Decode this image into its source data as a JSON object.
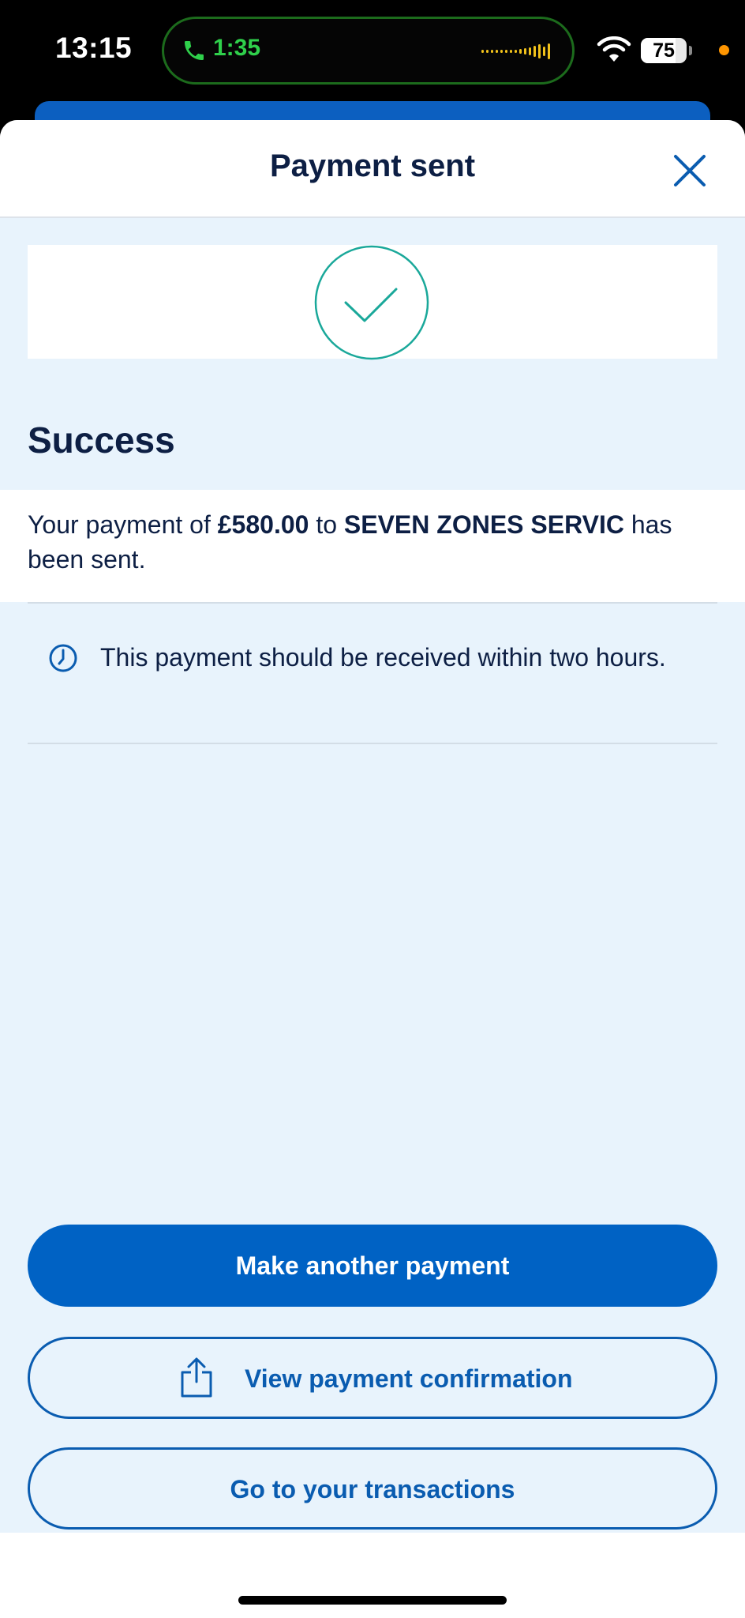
{
  "status_bar": {
    "time": "13:15",
    "call_time": "1:35",
    "battery_percent": "75",
    "battery_level": 0.75
  },
  "header": {
    "title": "Payment sent",
    "close_icon": "close-icon"
  },
  "result": {
    "icon": "checkmark-circle-icon",
    "heading": "Success",
    "message_prefix": "Your payment of ",
    "amount": "£580.00",
    "message_to": " to ",
    "payee": "SEVEN ZONES SERVIC",
    "message_suffix": " has been sent."
  },
  "info": {
    "icon": "clock-icon",
    "text": "This payment should be received within two hours."
  },
  "actions": {
    "make_another": "Make another payment",
    "view_confirmation": "View payment confirmation",
    "view_confirmation_icon": "share-icon",
    "go_transactions": "Go to your transactions"
  },
  "colors": {
    "primary": "#0062c4",
    "navy_text": "#0d1f44",
    "background": "#e8f3fc",
    "success_teal": "#1aa89a"
  }
}
